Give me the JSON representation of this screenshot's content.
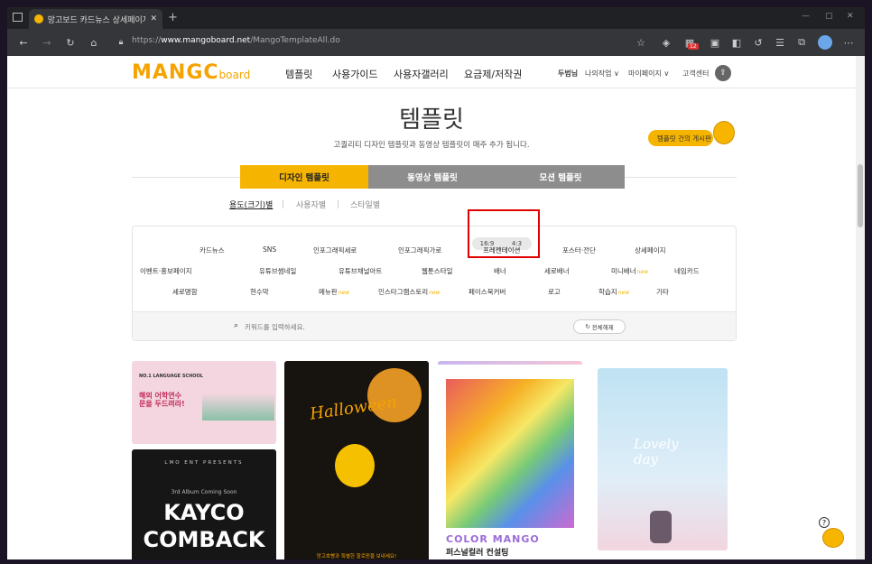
{
  "browser": {
    "tab_title": "망고보드 카드뉴스 상세페이지 ...",
    "url_prefix": "https://",
    "url_host": "www.mangoboard.net",
    "url_path": "/MangoTemplateAll.do",
    "badge_count": "12"
  },
  "header": {
    "logo_main": "MANGC",
    "logo_sub": "board",
    "nav": [
      "템플릿",
      "사용가이드",
      "사용자갤러리",
      "요금제/저작권"
    ],
    "user": "두범님",
    "my_work": "나의작업 ∨",
    "my_page": "마이페이지 ∨",
    "support": "고객센터"
  },
  "hero": {
    "title": "템플릿",
    "subtitle": "고퀄리티 디자인 템플릿과 동영상 템플릿이 매주 추가 됩니다.",
    "board_button": "템플릿 건의 게시판"
  },
  "content_tabs": [
    "디자인 템플릿",
    "동영상 템플릿",
    "모션 템플릿"
  ],
  "sub_tabs": [
    "용도(크기)별",
    "사용자별",
    "스타일별"
  ],
  "ratio_options": [
    "16:9",
    "4:3"
  ],
  "categories": {
    "row1": [
      "카드뉴스",
      "SNS",
      "인포그래픽세로",
      "인포그래픽가로",
      "프레젠테이션",
      "포스터·전단",
      "상세페이지"
    ],
    "row2": [
      "이벤트·홍보페이지",
      "유튜브썸네일",
      "유튜브채널아트",
      "웹툰스타일",
      "배너",
      "세로배너",
      "미니배너",
      "네임카드"
    ],
    "row3": [
      "세로명함",
      "현수막",
      "메뉴판",
      "인스타그램스토리",
      "페이스북커버",
      "로고",
      "학습지",
      "기타"
    ],
    "new_label": "new"
  },
  "search": {
    "placeholder": "키워드를 입력하세요.",
    "reset_label": "전체해제"
  },
  "cards": {
    "card1_tag": "NO.1 LANGUAGE SCHOOL",
    "card1_title": "해외 어학연수\n문을 두드려라!",
    "card2_title": "Halloween",
    "card2_footer": "망고호빵과 특별한 할로윈을 보내세요!",
    "card3_brand": "COLOR MANGO",
    "card3_title": "퍼스널컬러 컨설팅",
    "card4_title": "Lovely day",
    "card5_top": "LMO ENT PRESENTS",
    "card5_sub": "3rd Album Coming Soon",
    "card5_title1": "KAYCO",
    "card5_title2": "COMBACK"
  },
  "colors": {
    "accent": "#f5b400",
    "tab_inactive": "#8d8d8d",
    "highlight_box": "#e00000"
  }
}
